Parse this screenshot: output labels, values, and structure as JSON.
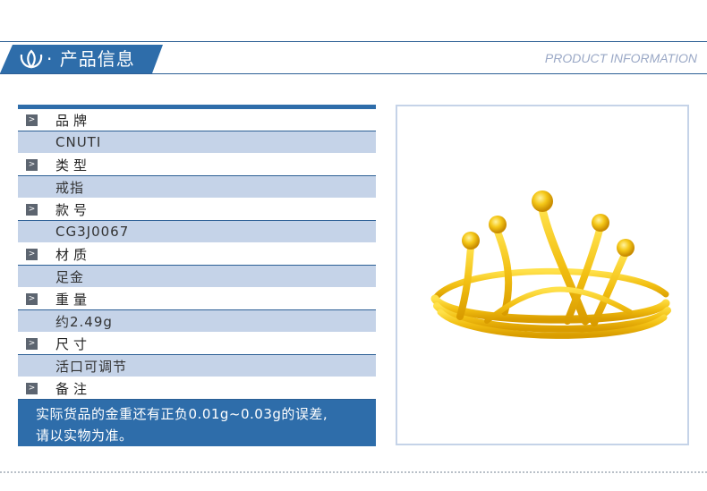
{
  "header": {
    "title": "· 产品信息",
    "title_en": "PRODUCT INFORMATION",
    "logo_icon": "lotus-logo-icon"
  },
  "table": {
    "bullet": ">",
    "rows": [
      {
        "label": "品牌",
        "value": "CNUTI"
      },
      {
        "label": "类型",
        "value": "戒指"
      },
      {
        "label": "款号",
        "value": "CG3J0067"
      },
      {
        "label": "材质",
        "value": "足金"
      },
      {
        "label": "重量",
        "value": "约2.49g"
      },
      {
        "label": "尺寸",
        "value": "活口可调节"
      }
    ],
    "note_label": "备注",
    "note_lines": [
      "实际货品的金重还有正负0.01g~0.03g的误差,",
      "请以实物为准。"
    ]
  },
  "image": {
    "subject": "gold-crown-ring-image"
  },
  "colors": {
    "primary_blue": "#2e6daa",
    "light_blue": "#c5d3e8",
    "bullet_gray": "#5d6570",
    "english_title": "#9aa8c6",
    "gold": "#f0c419"
  }
}
